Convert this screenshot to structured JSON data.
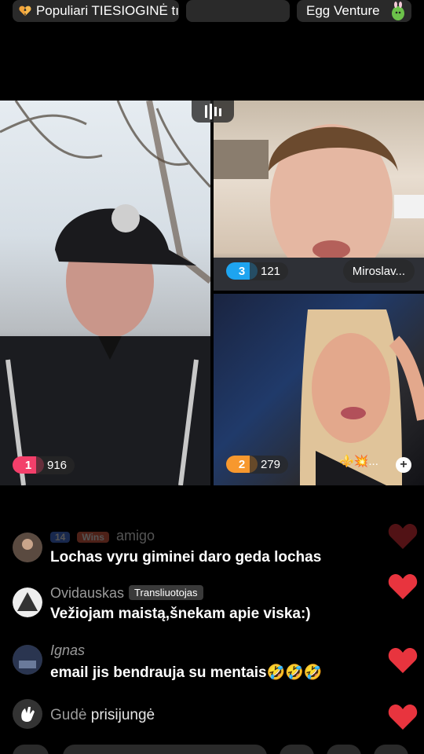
{
  "top": {
    "popular_label": "Populiari TIESIOGINĖ tı",
    "blank_label": "",
    "egg_label": "Egg Venture"
  },
  "grid": {
    "main": {
      "rank": "1",
      "score": "916"
    },
    "top_right": {
      "rank": "3",
      "score": "121",
      "name": "Miroslav..."
    },
    "bottom_right": {
      "rank": "2",
      "score": "279",
      "name_emoji": "⚜️💥..."
    }
  },
  "comments": [
    {
      "name": "amigo",
      "level": "14",
      "wins": "Wins",
      "text": "Lochas vyru giminei daro geda lochas"
    },
    {
      "name": "Ovidauskas",
      "badge": "Transliuotojas",
      "text": "Vežiojam maistą,šnekam apie viska:)"
    },
    {
      "name": "Ignas",
      "text": "email jis bendrauja su mentais🤣🤣🤣"
    },
    {
      "name": "Gudė",
      "text": "prisijungė"
    }
  ],
  "colors": {
    "rank1": "#f33f6a",
    "rank2": "#f7982e",
    "rank3": "#1ea4f0",
    "heart": "#e8343e"
  }
}
